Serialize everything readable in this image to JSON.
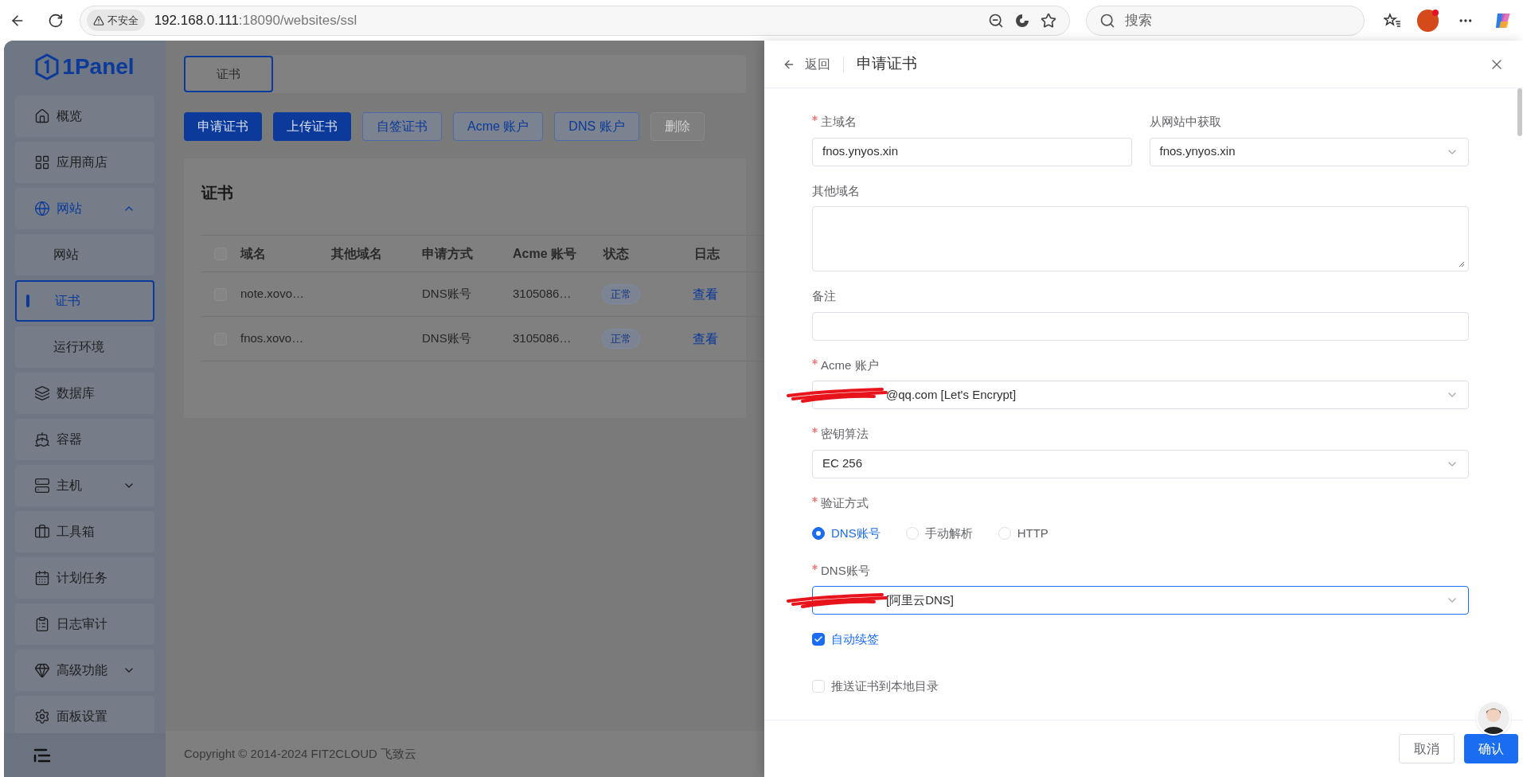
{
  "browser": {
    "security_label": "不安全",
    "url_host": "192.168.0.111",
    "url_rest": ":18090/websites/ssl",
    "search_placeholder": "搜索"
  },
  "sidebar": {
    "logo": "1Panel",
    "items": [
      {
        "label": "概览",
        "kind": "link",
        "selected": false
      },
      {
        "label": "应用商店",
        "kind": "link",
        "selected": false
      },
      {
        "label": "网站",
        "kind": "group",
        "expanded": true,
        "selected": false,
        "children": [
          {
            "label": "网站",
            "selected": false
          },
          {
            "label": "证书",
            "selected": true
          },
          {
            "label": "运行环境",
            "selected": false
          }
        ]
      },
      {
        "label": "数据库",
        "kind": "link",
        "selected": false
      },
      {
        "label": "容器",
        "kind": "link",
        "selected": false
      },
      {
        "label": "主机",
        "kind": "group",
        "expanded": false,
        "selected": false
      },
      {
        "label": "工具箱",
        "kind": "link",
        "selected": false
      },
      {
        "label": "计划任务",
        "kind": "link",
        "selected": false
      },
      {
        "label": "日志审计",
        "kind": "link",
        "selected": false
      },
      {
        "label": "高级功能",
        "kind": "group",
        "expanded": false,
        "selected": false
      },
      {
        "label": "面板设置",
        "kind": "link",
        "selected": false
      }
    ]
  },
  "tabs": [
    {
      "label": "证书",
      "selected": true
    }
  ],
  "toolbar": [
    {
      "label": "申请证书",
      "kind": "primary",
      "disabled": false
    },
    {
      "label": "上传证书",
      "kind": "primary",
      "disabled": false
    },
    {
      "label": "自签证书",
      "kind": "plain",
      "disabled": false
    },
    {
      "label": "Acme 账户",
      "kind": "plain",
      "disabled": false
    },
    {
      "label": "DNS 账户",
      "kind": "plain",
      "disabled": false
    },
    {
      "label": "删除",
      "kind": "plain",
      "disabled": true
    }
  ],
  "table": {
    "title": "证书",
    "select_all": false,
    "columns": [
      "域名",
      "其他域名",
      "申请方式",
      "Acme 账号",
      "状态",
      "日志"
    ],
    "rows": [
      {
        "checked": false,
        "domain": "note.xovo…",
        "method": "DNS账号",
        "acme": "3105086…",
        "status": "正常",
        "log": "查看"
      },
      {
        "checked": false,
        "domain": "fnos.xovo…",
        "method": "DNS账号",
        "acme": "3105086…",
        "status": "正常",
        "log": "查看"
      }
    ]
  },
  "footer": {
    "copyright": "Copyright © 2014-2024 FIT2CLOUD 飞致云"
  },
  "drawer": {
    "back": "返回",
    "title": "申请证书",
    "rows": [
      [
        {
          "kind": "input",
          "label": "主域名",
          "required": true,
          "value": "fnos.ynyos.xin"
        },
        {
          "kind": "select",
          "label": "从网站中获取",
          "required": false,
          "value": "fnos.ynyos.xin"
        }
      ],
      [
        {
          "kind": "textarea",
          "label": "其他域名",
          "required": false
        }
      ],
      [
        {
          "kind": "input",
          "label": "备注",
          "required": false
        }
      ],
      [
        {
          "kind": "select",
          "label": "Acme 账户",
          "required": true,
          "value": "@qq.com [Let's Encrypt]",
          "redacted": true
        }
      ],
      [
        {
          "kind": "select",
          "label": "密钥算法",
          "required": true,
          "value": "EC 256"
        }
      ],
      [
        {
          "kind": "radio",
          "label": "验证方式",
          "required": true,
          "options": [
            {
              "label": "DNS账号",
              "selected": true
            },
            {
              "label": "手动解析",
              "selected": false
            },
            {
              "label": "HTTP",
              "selected": false
            }
          ]
        }
      ],
      [
        {
          "kind": "select",
          "label": "DNS账号",
          "required": true,
          "value": "[阿里云DNS]",
          "redacted": true,
          "focused": true
        }
      ],
      [
        {
          "kind": "checkbox",
          "label": "自动续签",
          "checked": true
        }
      ],
      [
        {
          "kind": "checkbox",
          "label": "推送证书到本地目录",
          "checked": false
        }
      ]
    ],
    "buttons": [
      {
        "label": "取消",
        "kind": "plain"
      },
      {
        "label": "确认",
        "kind": "primary"
      }
    ]
  }
}
